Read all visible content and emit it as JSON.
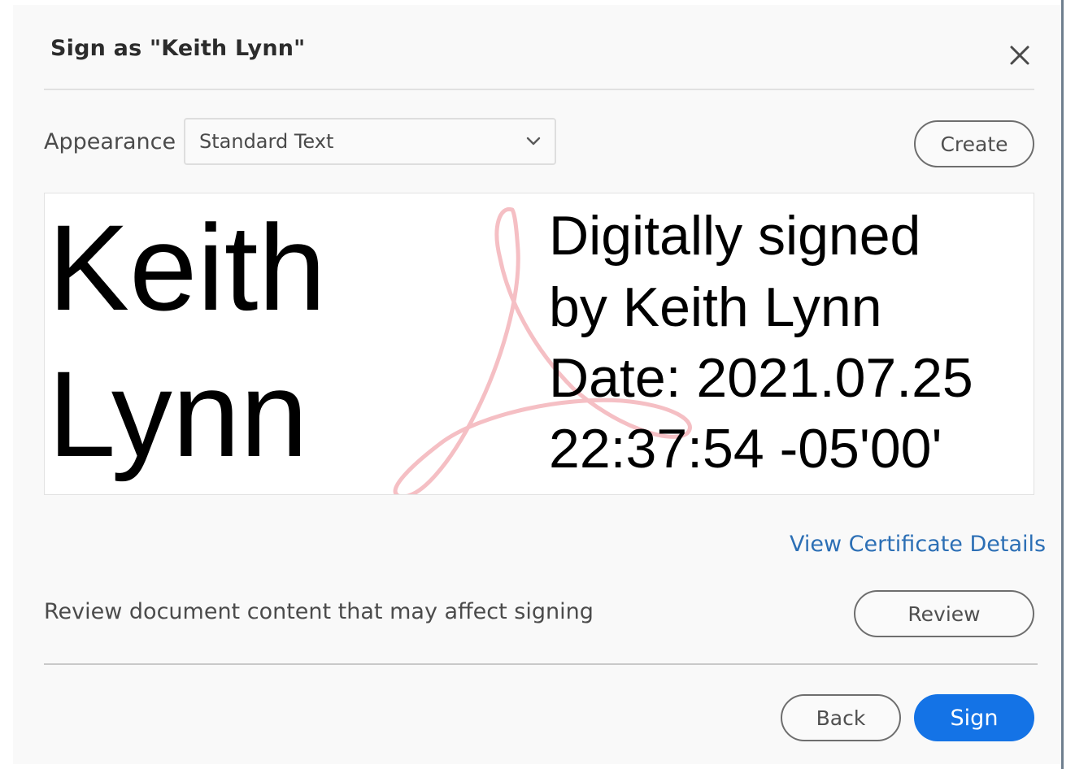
{
  "dialog": {
    "title": "Sign as \"Keith Lynn\"",
    "close_icon": "close-icon"
  },
  "appearance": {
    "label": "Appearance",
    "selected": "Standard Text",
    "create_label": "Create"
  },
  "preview": {
    "name_first": "Keith",
    "name_last": "Lynn",
    "details": [
      "Digitally signed",
      "by Keith Lynn",
      "Date: 2021.07.25",
      "22:37:54 -05'00'"
    ],
    "watermark_icon": "acrobat-logo-icon",
    "watermark_color": "#f4b8be"
  },
  "certificate": {
    "link_label": "View Certificate Details"
  },
  "review": {
    "text": "Review document content that may affect signing",
    "button_label": "Review"
  },
  "footer": {
    "back_label": "Back",
    "sign_label": "Sign"
  },
  "colors": {
    "accent": "#1473e6",
    "link": "#2c6fb5"
  }
}
